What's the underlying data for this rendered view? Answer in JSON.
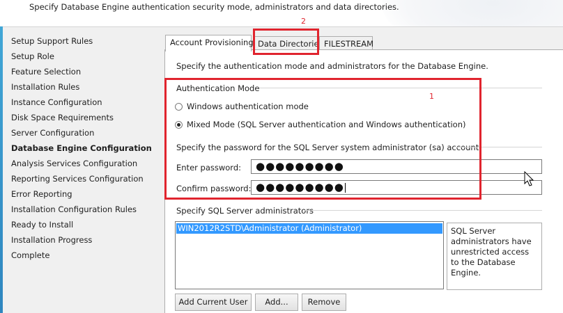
{
  "header": {
    "description": "Specify Database Engine authentication security mode, administrators and data directories."
  },
  "nav": {
    "items": [
      {
        "label": "Setup Support Rules"
      },
      {
        "label": "Setup Role"
      },
      {
        "label": "Feature Selection"
      },
      {
        "label": "Installation Rules"
      },
      {
        "label": "Instance Configuration"
      },
      {
        "label": "Disk Space Requirements"
      },
      {
        "label": "Server Configuration"
      },
      {
        "label": "Database Engine Configuration",
        "current": true
      },
      {
        "label": "Analysis Services Configuration"
      },
      {
        "label": "Reporting Services Configuration"
      },
      {
        "label": "Error Reporting"
      },
      {
        "label": "Installation Configuration Rules"
      },
      {
        "label": "Ready to Install"
      },
      {
        "label": "Installation Progress"
      },
      {
        "label": "Complete"
      }
    ]
  },
  "tabs": [
    {
      "label": "Account Provisioning",
      "active": true
    },
    {
      "label": "Data Directories"
    },
    {
      "label": "FILESTREAM"
    }
  ],
  "panel": {
    "intro": "Specify the authentication mode and administrators for the Database Engine.",
    "auth_group_title": "Authentication Mode",
    "radio_windows": "Windows authentication mode",
    "radio_mixed": "Mixed Mode (SQL Server authentication and Windows authentication)",
    "selected_mode": "mixed",
    "sa_group_title": "Specify the password for the SQL Server system administrator (sa) account.",
    "enter_password_label": "Enter password:",
    "enter_password_value": "●●●●●●●●●",
    "confirm_password_label": "Confirm password:",
    "confirm_password_value": "●●●●●●●●●",
    "admins_group_title": "Specify SQL Server administrators",
    "admins": [
      "WIN2012R2STD\\Administrator (Administrator)"
    ],
    "admins_info": "SQL Server administrators have unrestricted access to the Database Engine.",
    "buttons": {
      "add_current_user": "Add Current User",
      "add": "Add...",
      "remove": "Remove"
    }
  },
  "annotations": {
    "box1_label": "1",
    "box2_label": "2",
    "color": "#e0242e"
  },
  "colors": {
    "selection": "#3399ff",
    "left_strip": "#41a6d6"
  }
}
